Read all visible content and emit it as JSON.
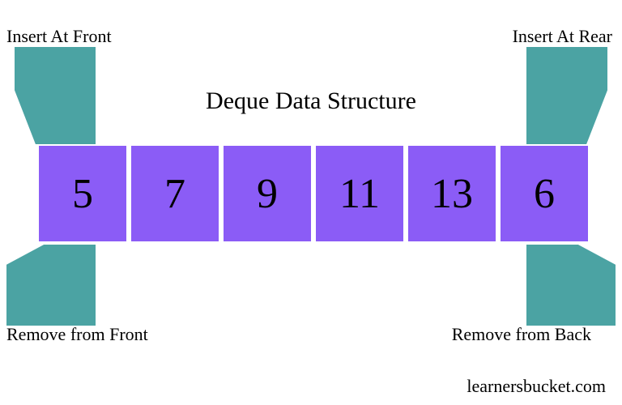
{
  "title": "Deque Data Structure",
  "labels": {
    "insert_front": "Insert At Front",
    "insert_rear": "Insert At Rear",
    "remove_front": "Remove from Front",
    "remove_back": "Remove from Back"
  },
  "cells": [
    "5",
    "7",
    "9",
    "11",
    "13",
    "6"
  ],
  "watermark": "learnersbucket.com",
  "colors": {
    "cell_bg": "#8b5cf6",
    "arrow": "#4ba3a3"
  },
  "chart_data": {
    "type": "table",
    "title": "Deque Data Structure",
    "values": [
      5,
      7,
      9,
      11,
      13,
      6
    ],
    "operations": [
      {
        "name": "Insert At Front",
        "position": "front",
        "action": "insert"
      },
      {
        "name": "Insert At Rear",
        "position": "rear",
        "action": "insert"
      },
      {
        "name": "Remove from Front",
        "position": "front",
        "action": "remove"
      },
      {
        "name": "Remove from Back",
        "position": "rear",
        "action": "remove"
      }
    ]
  }
}
